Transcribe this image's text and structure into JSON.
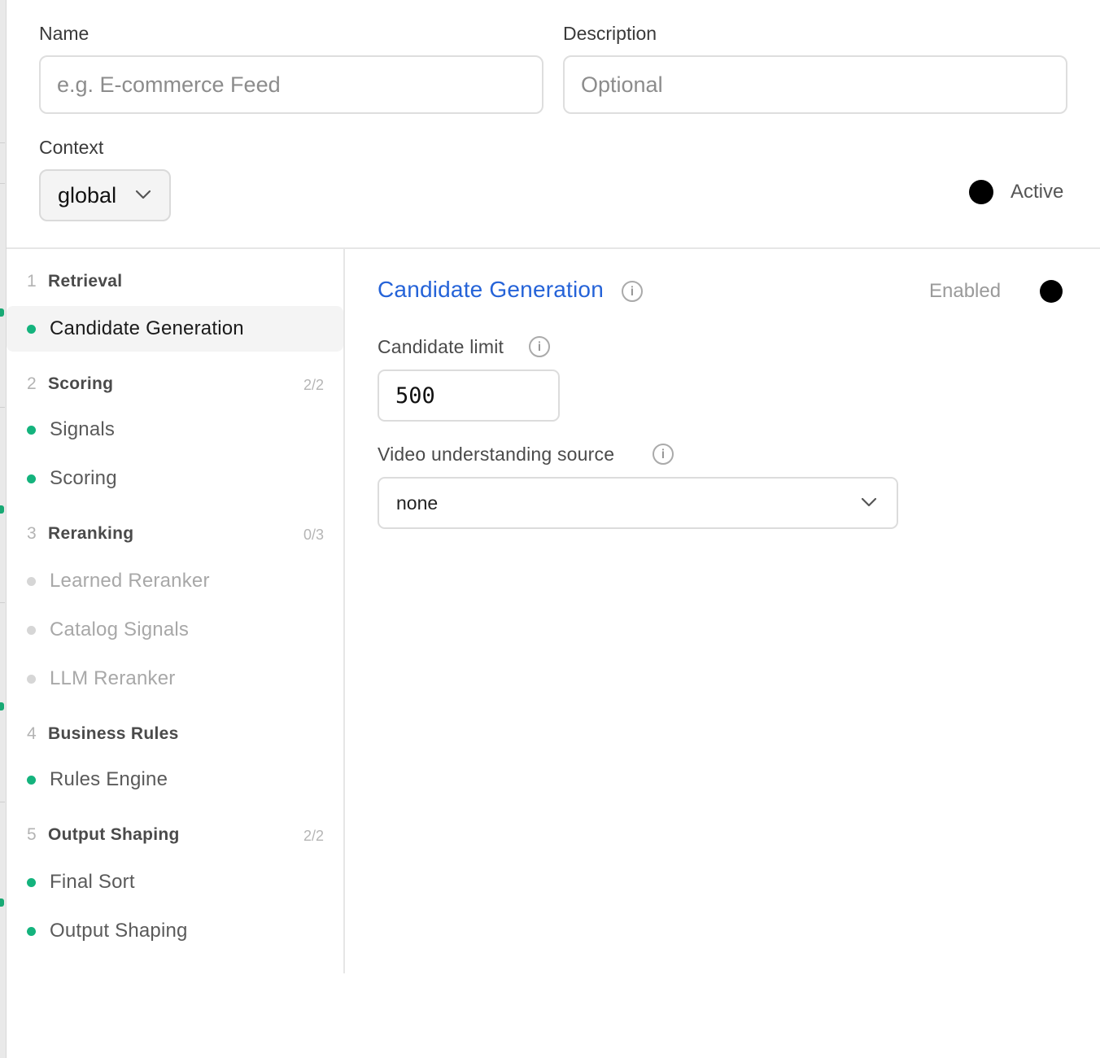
{
  "form": {
    "name_label": "Name",
    "name_placeholder": "e.g. E-commerce Feed",
    "name_value": "",
    "description_label": "Description",
    "description_placeholder": "Optional",
    "description_value": "",
    "context_label": "Context",
    "context_value": "global",
    "active_label": "Active"
  },
  "sidebar": {
    "groups": [
      {
        "number": "1",
        "title": "Retrieval",
        "count": ""
      },
      {
        "number": "2",
        "title": "Scoring",
        "count": "2/2"
      },
      {
        "number": "3",
        "title": "Reranking",
        "count": "0/3"
      },
      {
        "number": "4",
        "title": "Business Rules",
        "count": ""
      },
      {
        "number": "5",
        "title": "Output Shaping",
        "count": "2/2"
      }
    ],
    "items": [
      {
        "label": "Candidate Generation",
        "enabled": true,
        "selected": true
      },
      {
        "label": "Signals",
        "enabled": true,
        "selected": false
      },
      {
        "label": "Scoring",
        "enabled": true,
        "selected": false
      },
      {
        "label": "Learned Reranker",
        "enabled": false,
        "selected": false
      },
      {
        "label": "Catalog Signals",
        "enabled": false,
        "selected": false
      },
      {
        "label": "LLM Reranker",
        "enabled": false,
        "selected": false
      },
      {
        "label": "Rules Engine",
        "enabled": true,
        "selected": false
      },
      {
        "label": "Final Sort",
        "enabled": true,
        "selected": false
      },
      {
        "label": "Output Shaping",
        "enabled": true,
        "selected": false
      }
    ]
  },
  "panel": {
    "title": "Candidate Generation",
    "enabled_label": "Enabled",
    "candidate_limit_label": "Candidate limit",
    "candidate_limit_value": "500",
    "video_source_label": "Video understanding source",
    "video_source_value": "none"
  },
  "icons": {
    "info": "info-circle-icon",
    "chevron": "chevron-down-icon",
    "status_dot": "status-dot-icon"
  },
  "colors": {
    "accent_blue": "#2563d8",
    "enabled_green": "#14b37d",
    "disabled_gray": "#d6d6d6",
    "toggle_black": "#000000"
  }
}
